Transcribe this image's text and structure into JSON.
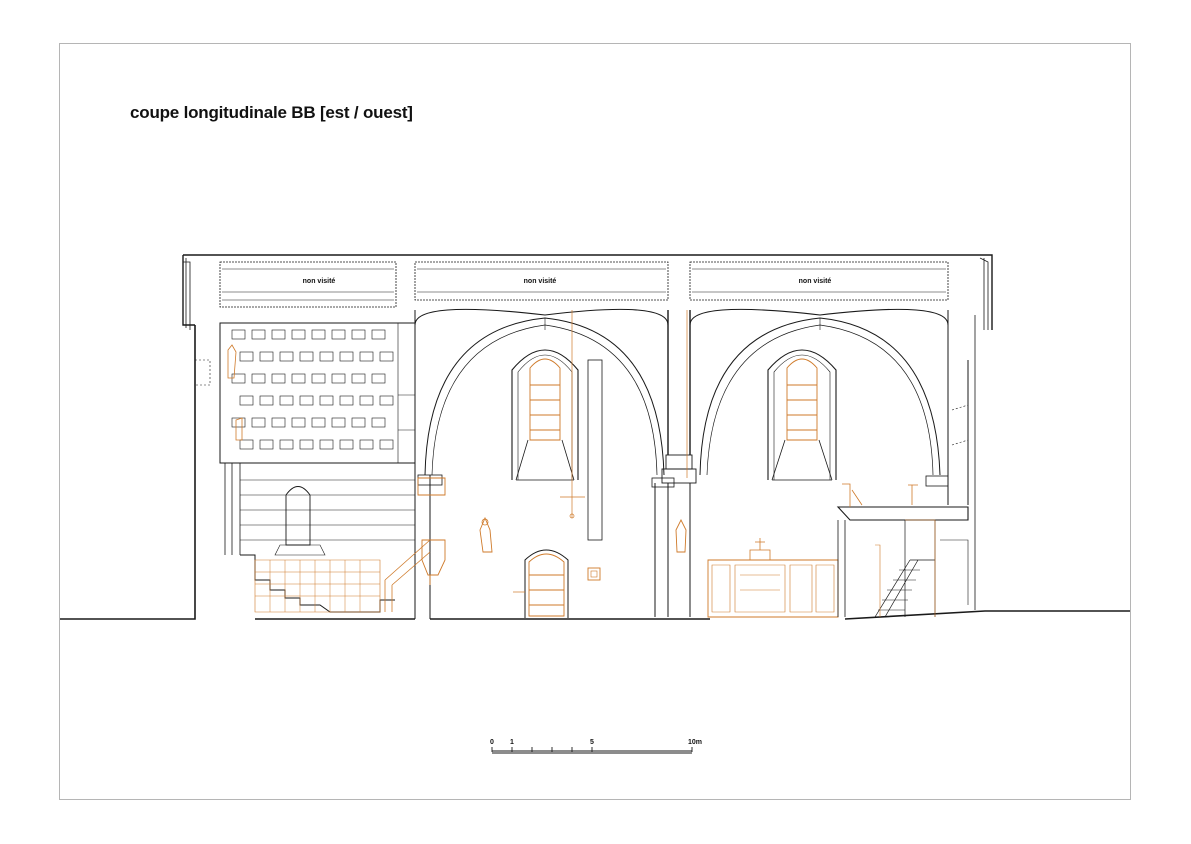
{
  "title": "coupe longitudinale BB [est / ouest]",
  "unvisited_label": "non visité",
  "scale_bar": {
    "ticks": [
      "0",
      "1",
      "5",
      "10m"
    ]
  },
  "colors": {
    "structure": "#1a1a1a",
    "furniture": "#cf7a2a",
    "frame": "#b5b5b5"
  }
}
